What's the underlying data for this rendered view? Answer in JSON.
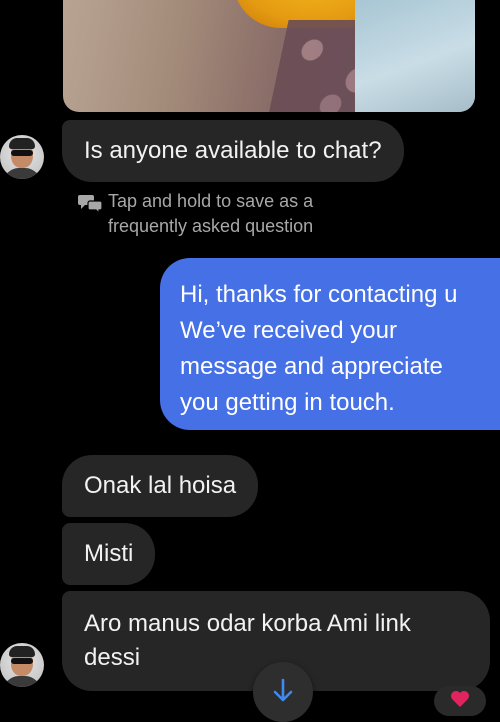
{
  "conversation": {
    "attachment": {
      "icon": "photo-attachment"
    },
    "messages": [
      {
        "id": "m1",
        "direction": "incoming",
        "text": "Is anyone available to chat?"
      },
      {
        "id": "m2",
        "direction": "outgoing",
        "lines": [
          "Hi, thanks for contacting u",
          "We’ve received your",
          "message and appreciate",
          "you getting in touch."
        ]
      },
      {
        "id": "m3",
        "direction": "incoming",
        "text": "Onak lal hoisa"
      },
      {
        "id": "m4",
        "direction": "incoming",
        "text": "Misti"
      },
      {
        "id": "m5",
        "direction": "incoming",
        "text": "Aro manus odar korba Ami link dessi"
      }
    ],
    "faq_hint": {
      "icon": "chat-bubbles-icon",
      "text": "Tap and hold to save as a frequently asked question"
    },
    "scroll_button": {
      "icon": "arrow-down-icon"
    },
    "reaction": {
      "icon": "heart-icon"
    }
  },
  "colors": {
    "background": "#000000",
    "incoming_bubble": "#262626",
    "outgoing_bubble": "#4670e6",
    "hint_text": "#a8a8a8",
    "scroll_arrow": "#3d8bf2",
    "reaction_heart": "#e0245e"
  }
}
